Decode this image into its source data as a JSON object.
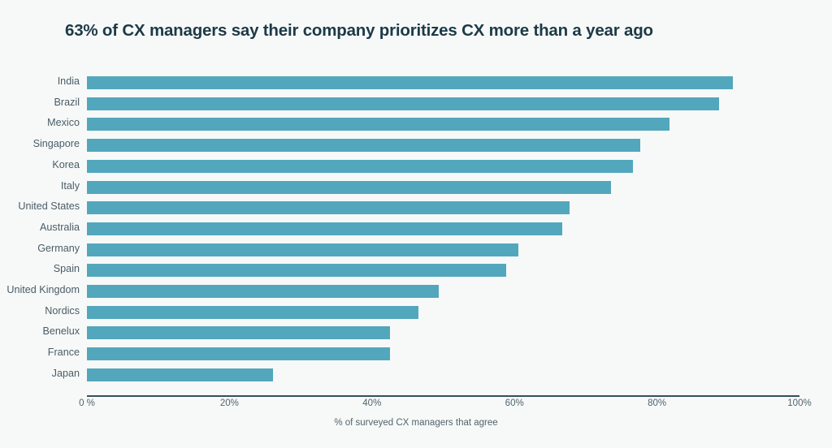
{
  "chart_data": {
    "type": "bar",
    "orientation": "horizontal",
    "title": "63% of CX managers say their company prioritizes CX more than a year ago",
    "xlabel": "% of surveyed CX managers that agree",
    "ylabel": "",
    "xlim": [
      0,
      100
    ],
    "grid": false,
    "legend": null,
    "bar_color": "#52a7bc",
    "background_color": "#f7f9f8",
    "title_color": "#1c3a47",
    "label_color": "#4a5c66",
    "axis_color": "#33505c",
    "xticks": [
      0,
      20,
      40,
      60,
      80,
      100
    ],
    "xtick_labels": [
      "0 %",
      "20%",
      "40%",
      "60%",
      "80%",
      "100%"
    ],
    "categories": [
      "India",
      "Brazil",
      "Mexico",
      "Singapore",
      "Korea",
      "Italy",
      "United States",
      "Australia",
      "Germany",
      "Spain",
      "United Kingdom",
      "Nordics",
      "Benelux",
      "France",
      "Japan"
    ],
    "values": [
      90.6,
      88.7,
      81.7,
      77.7,
      76.6,
      73.6,
      67.7,
      66.7,
      60.5,
      58.8,
      49.4,
      46.5,
      42.5,
      42.5,
      26.1
    ]
  }
}
